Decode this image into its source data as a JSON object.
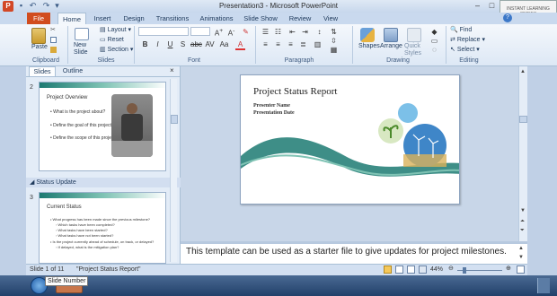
{
  "window": {
    "title": "Presentation3 - Microsoft PowerPoint",
    "watermark": "INSTANT LEARNING SERIES"
  },
  "tabs": [
    "File",
    "Home",
    "Insert",
    "Design",
    "Transitions",
    "Animations",
    "Slide Show",
    "Review",
    "View"
  ],
  "ribbon": {
    "clipboard": {
      "paste": "Paste",
      "label": "Clipboard"
    },
    "slides": {
      "new_slide": "New Slide",
      "layout": "Layout",
      "reset": "Reset",
      "section": "Section",
      "label": "Slides"
    },
    "font": {
      "label": "Font"
    },
    "paragraph": {
      "label": "Paragraph"
    },
    "drawing": {
      "shapes": "Shapes",
      "arrange": "Arrange",
      "quick_styles": "Quick Styles",
      "label": "Drawing"
    },
    "editing": {
      "find": "Find",
      "replace": "Replace",
      "select": "Select",
      "label": "Editing"
    }
  },
  "left_pane": {
    "tabs": [
      "Slides",
      "Outline"
    ],
    "section_name": "Status Update",
    "thumbs": [
      {
        "num": "2",
        "title": "Project Overview",
        "bullets": [
          "What is the project about?",
          "Define the goal of this project",
          "Define the scope of this project"
        ]
      },
      {
        "num": "3",
        "title": "Current Status",
        "bullets": [
          "What progress has been made since the previous milestone?",
          "Which tasks have been completed?",
          "What tasks have been started?",
          "What tasks have not been started?",
          "Is the project currently ahead of schedule, on track, or delayed?",
          "If delayed, what is the mitigation plan?"
        ]
      }
    ]
  },
  "slide": {
    "title": "Project Status Report",
    "presenter": "Presenter Name",
    "date": "Presentation Date"
  },
  "notes": {
    "text": "This template can be used as a starter file to give updates for project milestones."
  },
  "status_bar": {
    "slide_count": "Slide 1 of 11",
    "theme": "\"Project Status Report\"",
    "zoom": "44%"
  },
  "taskbar": {
    "tooltip": "Slide Number"
  },
  "colors": {
    "file_tab": "#d14c1e",
    "teal_wave": "#1c7a72",
    "taskbar": "#2b4a74"
  }
}
